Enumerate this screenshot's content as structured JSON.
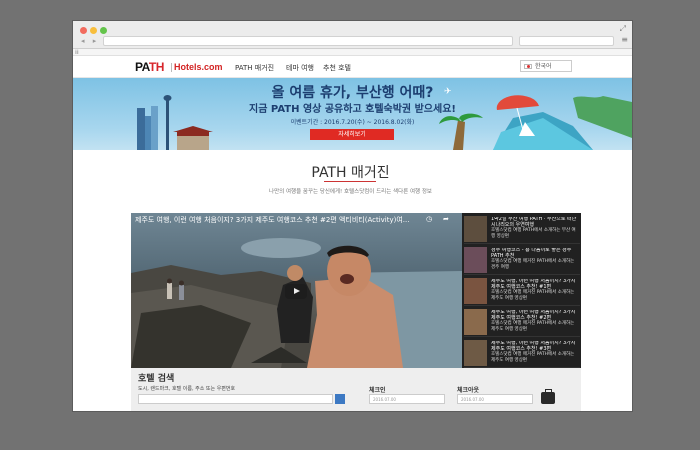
{
  "browser": {
    "back_glyph": "◂ ▸",
    "bookmark_glyph": "≡"
  },
  "header": {
    "logo_path_a": "PA",
    "logo_path_b": "TH",
    "logo_hotels": "Hotels.com",
    "nav": [
      "PATH 매거진",
      "테마 여행",
      "추천 호텔"
    ],
    "language": "한국어"
  },
  "banner": {
    "line1": "올 여름 휴가, 부산행 어때?",
    "line2": "지금 PATH 영상 공유하고 호텔숙박권 받으세요!",
    "line3": "이벤트기간 : 2016.7.20(수) ~ 2016.8.02(화)",
    "button": "자세히보기"
  },
  "page": {
    "title": "PATH 매거진",
    "subtitle": "나만의 여행을 꿈꾸는 당신에게! 호텔스닷컴이 드리는 색다른 여행 정보"
  },
  "video": {
    "title": "제주도 여행, 이런 여행 처음이지? 3가지 제주도 여행코스 추천 #2편 액티비티(Activity)여..."
  },
  "playlist": [
    {
      "title": "1박2일 부산 여행 PATH · 부산으로 떠난 시나리오의 우연여행",
      "desc": "호텔스닷컴 여행 PATH에서 소개하는 부산 여행 영상편"
    },
    {
      "title": "경주 여행코스 - 흥 나음이로 좋은 경주 PATH 추천",
      "desc": "호텔스닷컴 여행 매거진 PATH에서 소개하는 경주 여행"
    },
    {
      "title": "제주도 여행, 이런 여행 처음이지? 3가지 제주도 여행코스 추천! #1편",
      "desc": "호텔스닷컴 여행 매거진 PATH에서 소개하는 제주도 여행 영상편"
    },
    {
      "title": "제주도 여행, 이런 여행 처음이지? 3가지 제주도 여행코스 추천! #2편",
      "desc": "호텔스닷컴 여행 매거진 PATH에서 소개하는 제주도 여행 영상편"
    },
    {
      "title": "제주도 여행, 이런 여행 처음이지? 3가지 제주도 여행코스 추천! #3편",
      "desc": "호텔스닷컴 여행 매거진 PATH에서 소개하는 제주도 여행 영상편"
    }
  ],
  "search": {
    "title": "호텔 검색",
    "label": "도시, 랜드마크, 호텔 이름, 주소 또는 우편번호",
    "checkin": "체크인",
    "checkout": "체크아웃",
    "checkin_value": "2016.07.00",
    "checkout_value": "2016.07.00"
  }
}
